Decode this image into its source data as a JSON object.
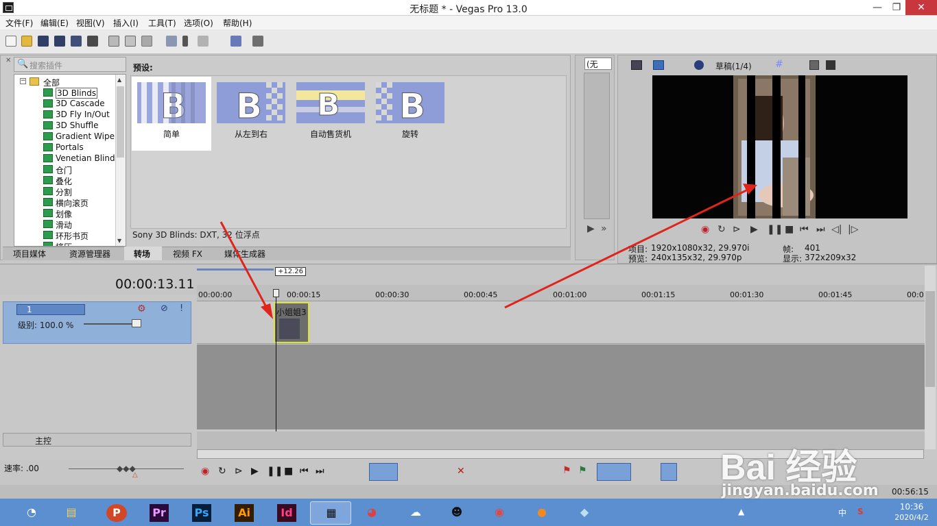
{
  "window": {
    "title": "无标题 * - Vegas Pro 13.0"
  },
  "menu": [
    "文件(F)",
    "编辑(E)",
    "视图(V)",
    "插入(I)",
    "工具(T)",
    "选项(O)",
    "帮助(H)"
  ],
  "plugins": {
    "search_placeholder": "搜索插件",
    "presets_label": "预设:",
    "tree_root": "全部",
    "tree_items": [
      "3D Blinds",
      "3D Cascade",
      "3D Fly In/Out",
      "3D Shuffle",
      "Gradient Wipe",
      "Portals",
      "Venetian Blinds",
      "仓门",
      "叠化",
      "分割",
      "横向滚页",
      "划像",
      "滑动",
      "环形书页",
      "挤压"
    ],
    "presets": [
      "简单",
      "从左到右",
      "自动售货机",
      "旋转"
    ],
    "description": "Sony 3D Blinds: DXT, 32 位浮点",
    "tabs": [
      "项目媒体",
      "资源管理器",
      "转场",
      "视频 FX",
      "媒体生成器"
    ]
  },
  "trimmer": {
    "dropdown": "(无"
  },
  "preview": {
    "quality": "草稿(1/4)",
    "project_label": "项目:",
    "project_value": "1920x1080x32, 29.970i",
    "preview_label": "预览:",
    "preview_value": "240x135x32, 29.970p",
    "frame_label": "帧:",
    "frame_value": "401",
    "display_label": "显示:",
    "display_value": "372x209x32"
  },
  "timeline": {
    "timecode": "00:00:13.11",
    "loop_badge": "+12.26",
    "ticks": [
      "00:00:00",
      "00:00:15",
      "00:00:30",
      "00:00:45",
      "00:01:00",
      "00:01:15",
      "00:01:30",
      "00:01:45",
      "00:0"
    ],
    "track_number": "1",
    "track_level": "级别: 100.0 %",
    "clip_label": "小姐姐3",
    "master_label": "主控",
    "rate": "速率: .00",
    "status_time": "00:56:15"
  },
  "taskbar": {
    "apps": [
      "browser",
      "explorer",
      "powerpoint",
      "premiere",
      "photoshop",
      "illustrator",
      "indesign",
      "vegas",
      "app",
      "app",
      "qq",
      "chrome",
      "app",
      "app"
    ],
    "labels": {
      "pr": "Pr",
      "ps": "Ps",
      "ai": "Ai",
      "id": "Id"
    },
    "ime": "中",
    "clock": "10:36",
    "date": "2020/4/2"
  },
  "watermark": {
    "brand": "Bai 经验",
    "url": "jingyan.baidu.com"
  },
  "colors": {
    "taskbar": "#5b8fd0",
    "track_header": "#8fb0d8",
    "clip_border": "#d9e43a",
    "arrow": "#e0241c"
  }
}
